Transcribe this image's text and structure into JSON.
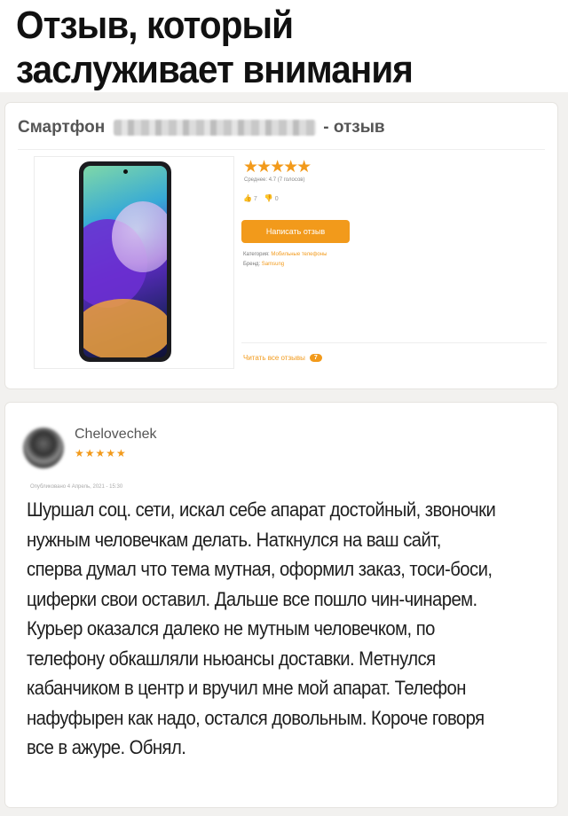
{
  "headline": "Отзыв, который заслуживает внимания",
  "product": {
    "title_prefix": "Смартфон",
    "title_suffix": "- отзыв",
    "stars": "★★★★★",
    "average": "Среднее: 4.7  (7 голосов)",
    "likes": "7",
    "dislikes": "0",
    "write_review_label": "Написать отзыв",
    "category_label": "Категория:",
    "category_value": "Мобильные телефоны",
    "brand_label": "Бренд:",
    "brand_value": "Samsung",
    "read_all_label": "Читать все отзывы",
    "read_all_count": "7"
  },
  "review": {
    "author": "Chelovechek",
    "stars": "★★★★★",
    "published": "Опубликовано 4 Апрель, 2021 - 15:30",
    "paragraph1": "Шуршал соц. сети, искал себе апарат достойный, звоночки нужным человечкам делать. Наткнулся на ваш сайт, сперва думал что тема мутная, оформил заказ, тоси-боси, циферки свои оставил. Дальше все пошло чин-чинарем.",
    "paragraph2": "Курьер оказался далеко не мутным человечком, по телефону обкашляли ньюансы доставки. Метнулся кабанчиком в центр и вручил мне мой апарат. Телефон нафуфырен как надо, остался довольным. Короче говоря все в ажуре. Обнял."
  },
  "colors": {
    "accent": "#f29a1b",
    "page_bg": "#f2f1ef"
  }
}
